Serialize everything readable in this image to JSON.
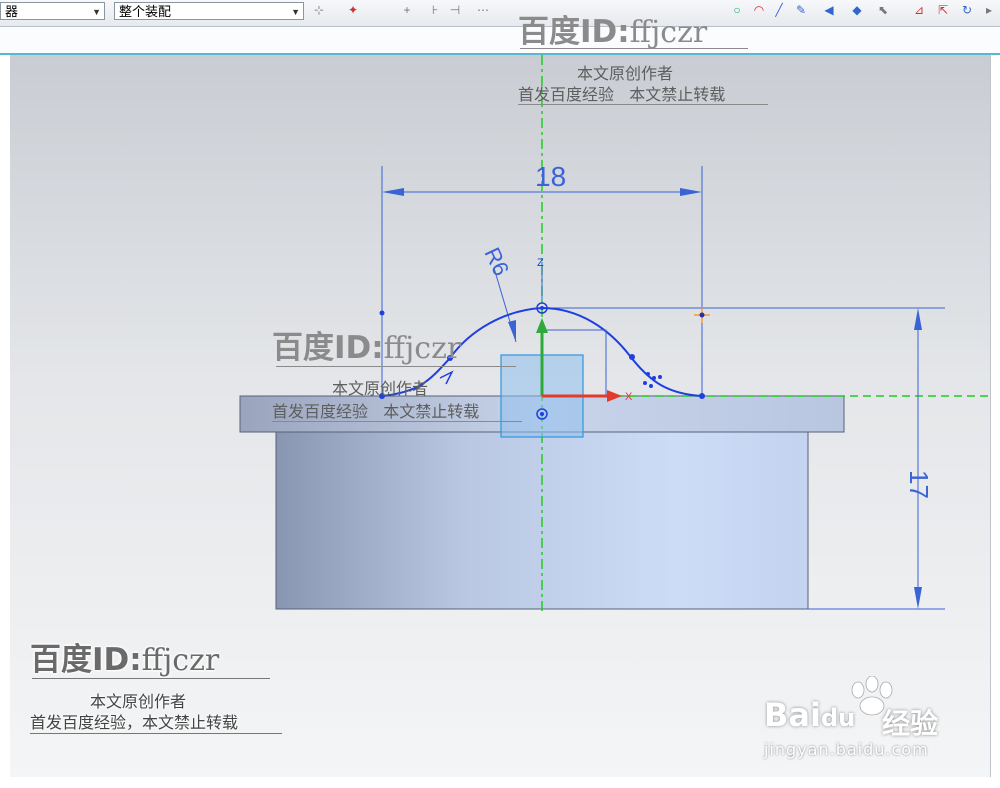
{
  "toolbar": {
    "combo_left": "器",
    "combo_assembly": "整个装配"
  },
  "dimensions": {
    "width": "18",
    "radius": "R6",
    "height": "17"
  },
  "axes": {
    "z": "Z",
    "x": "X"
  },
  "watermarks": {
    "id_prefix": "百度ID:",
    "id_name": "ffjczr",
    "line1": "本文原创作者",
    "line2a": "首发百度经验",
    "line2b": "本文禁止转载",
    "line2_combined": "首发百度经验，本文禁止转载"
  },
  "brand": {
    "logo": "Bai",
    "logo_du": "du",
    "logo_cn": "经验",
    "url": "jingyan.baidu.com"
  },
  "colors": {
    "sketch_blue": "#1f3fe0",
    "dim_blue": "#3a63d6",
    "axis_green": "#22cc22",
    "body_light": "#c5d6f2",
    "body_dark": "#8e9cb8"
  }
}
